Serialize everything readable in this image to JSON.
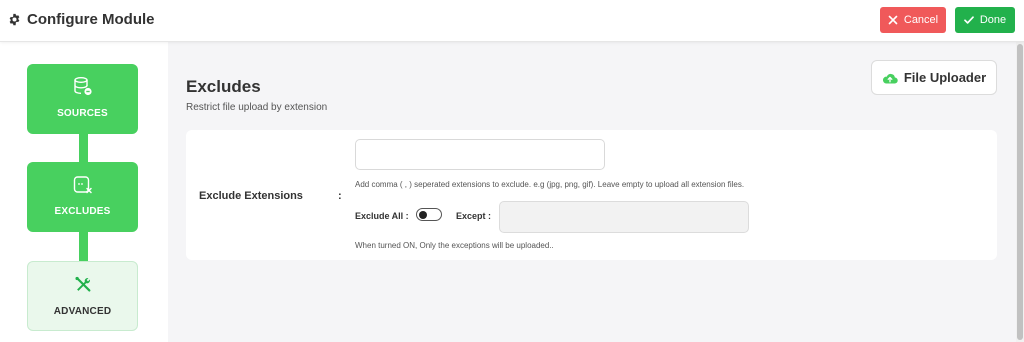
{
  "header": {
    "title": "Configure Module",
    "cancel_label": "Cancel",
    "done_label": "Done"
  },
  "steps": [
    {
      "label": "SOURCES",
      "state": "active",
      "icon": "database-icon"
    },
    {
      "label": "EXCLUDES",
      "state": "active",
      "icon": "exclude-file-icon"
    },
    {
      "label": "ADVANCED",
      "state": "inactive",
      "icon": "tools-icon"
    }
  ],
  "main": {
    "heading": "Excludes",
    "subheading": "Restrict file upload by extension",
    "uploader_button": "File Uploader",
    "field_label": "Exclude Extensions",
    "colon": ":",
    "extensions_value": "",
    "extensions_help": "Add comma ( , ) seperated extensions to exclude. e.g (jpg, png, gif). Leave empty to upload all extension files.",
    "exclude_all_label": "Exclude All :",
    "exclude_all_on": false,
    "except_label": "Except :",
    "except_value": "",
    "except_help": "When turned ON, Only the exceptions will be uploaded.."
  },
  "colors": {
    "accent_green": "#48d05f",
    "done_green": "#22b14c",
    "cancel_red": "#f0595a",
    "inactive_step_bg": "#eaf8ec"
  }
}
